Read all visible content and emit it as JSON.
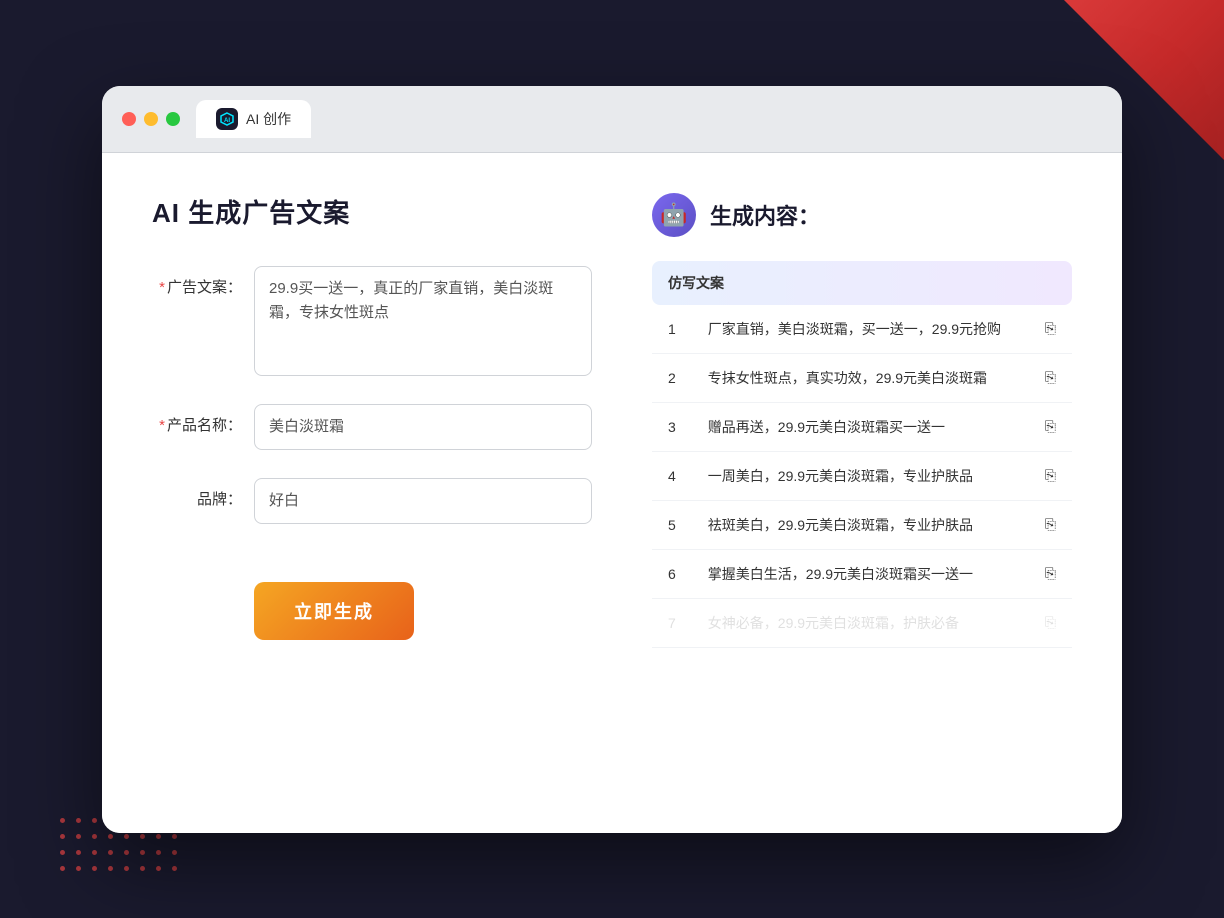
{
  "tab": {
    "label": "AI 创作"
  },
  "leftPanel": {
    "title": "AI 生成广告文案",
    "fields": {
      "adCopy": {
        "label": "广告文案：",
        "placeholder": "29.9买一送一，真正的厂家直销，美白淡斑霜，专抹女性斑点",
        "value": "29.9买一送一，真正的厂家直销，美白淡斑霜，专抹女性斑点"
      },
      "productName": {
        "label": "产品名称：",
        "value": "美白淡斑霜"
      },
      "brand": {
        "label": "品牌：",
        "value": "好白"
      }
    },
    "generateButton": "立即生成"
  },
  "rightPanel": {
    "title": "生成内容：",
    "tableHeader": "仿写文案",
    "results": [
      {
        "num": "1",
        "text": "厂家直销，美白淡斑霜，买一送一，29.9元抢购",
        "dimmed": false
      },
      {
        "num": "2",
        "text": "专抹女性斑点，真实功效，29.9元美白淡斑霜",
        "dimmed": false
      },
      {
        "num": "3",
        "text": "赠品再送，29.9元美白淡斑霜买一送一",
        "dimmed": false
      },
      {
        "num": "4",
        "text": "一周美白，29.9元美白淡斑霜，专业护肤品",
        "dimmed": false
      },
      {
        "num": "5",
        "text": "祛斑美白，29.9元美白淡斑霜，专业护肤品",
        "dimmed": false
      },
      {
        "num": "6",
        "text": "掌握美白生活，29.9元美白淡斑霜买一送一",
        "dimmed": false
      },
      {
        "num": "7",
        "text": "女神必备，29.9元美白淡斑霜，护肤必备",
        "dimmed": true
      }
    ]
  }
}
